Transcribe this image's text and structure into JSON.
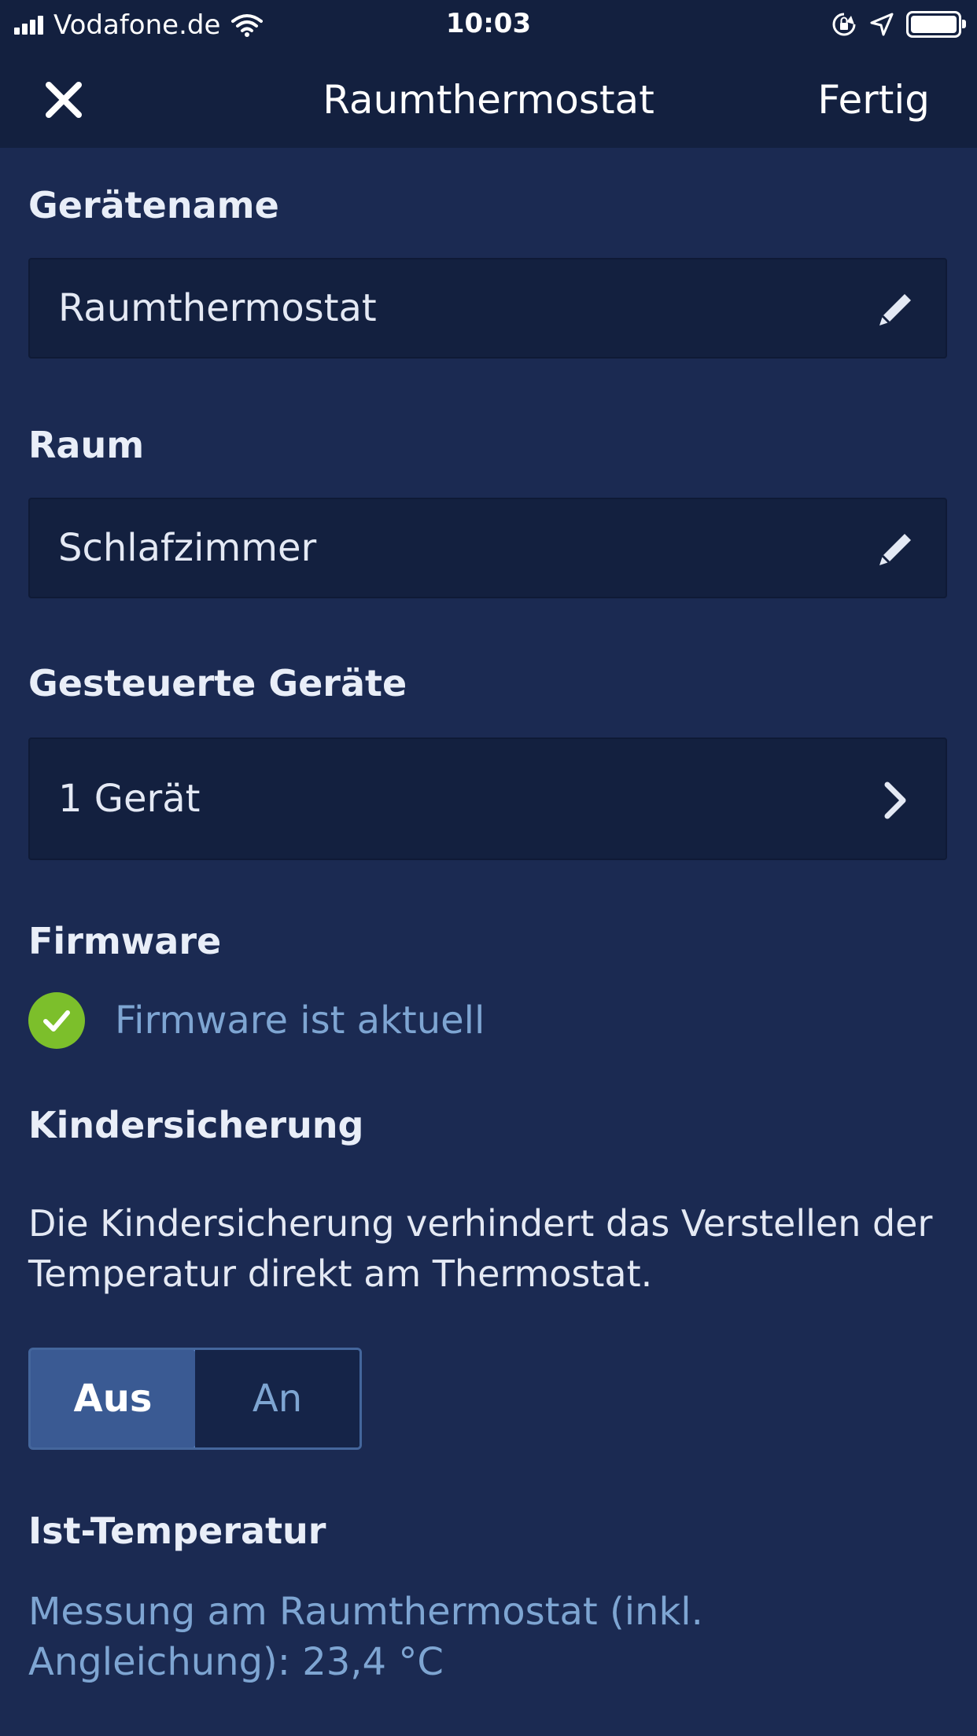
{
  "status_bar": {
    "carrier": "Vodafone.de",
    "time": "10:03",
    "icons": [
      "signal-icon",
      "wifi-icon",
      "orientation-lock-icon",
      "location-icon",
      "battery-icon"
    ]
  },
  "nav": {
    "close_icon": "close-icon",
    "title": "Raumthermostat",
    "done_label": "Fertig"
  },
  "device_name": {
    "label": "Gerätename",
    "value": "Raumthermostat",
    "icon": "pencil-icon"
  },
  "room": {
    "label": "Raum",
    "value": "Schlafzimmer",
    "icon": "pencil-icon"
  },
  "controlled_devices": {
    "label": "Gesteuerte Geräte",
    "value": "1 Gerät",
    "icon": "chevron-right-icon"
  },
  "firmware": {
    "label": "Firmware",
    "status": "Firmware ist aktuell",
    "icon": "check-circle-icon",
    "status_color": "#7cbf2b"
  },
  "child_lock": {
    "label": "Kindersicherung",
    "description": "Die Kindersicherung verhindert das Verstellen der Temperatur direkt am Thermostat.",
    "options": [
      "Aus",
      "An"
    ],
    "selected": "Aus"
  },
  "actual_temperature": {
    "label": "Ist-Temperatur",
    "measurement": "Messung am Raumthermostat (inkl. Angleichung): 23,4 °C"
  },
  "colors": {
    "background": "#1b2a52",
    "header": "#13203f",
    "accent_text": "#7ea5d2",
    "toggle_active": "#3a5a93"
  }
}
